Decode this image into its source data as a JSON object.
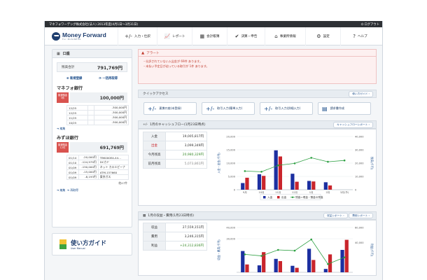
{
  "topbar": {
    "company": "マネフォワーデング株式会社(法人)  2013年度(4月1日〜3月31日)",
    "logout": "ログアウト"
  },
  "brand": {
    "name": "Money Forward",
    "sub": "For BUSINESS"
  },
  "nav": [
    {
      "icon": "plus-minus-icon",
      "glyph": "+/-",
      "label": "入力・仕訳"
    },
    {
      "icon": "chart-icon",
      "glyph": "📈",
      "label": "レポート"
    },
    {
      "icon": "ledger-icon",
      "glyph": "▦",
      "label": "会計帳簿"
    },
    {
      "icon": "check-icon",
      "glyph": "✔",
      "label": "決算・申告"
    },
    {
      "icon": "home-icon",
      "glyph": "⌂",
      "label": "事業所情報"
    },
    {
      "icon": "gear-icon",
      "glyph": "⚙",
      "label": "設定"
    },
    {
      "icon": "help-icon",
      "glyph": "?",
      "label": "ヘルプ"
    }
  ],
  "accounts": {
    "title": "口座",
    "balance_label": "残高合計",
    "balance": "791,769円",
    "new_button": "新規登録",
    "refresh_button": "一括再取得",
    "banks": [
      {
        "name": "マネフォ銀行",
        "tag": "普通預金\n3件",
        "amount": "100,000円",
        "rows": [
          [
            "12/25",
            "",
            "-300,000円"
          ],
          [
            "12/25",
            "",
            "-300,000円"
          ],
          [
            "11/25",
            "",
            "-300,000円"
          ],
          [
            "10/25",
            "",
            "-300,000円"
          ]
        ],
        "link": "編集"
      },
      {
        "name": "みずほ銀行",
        "tag": "普通預金\n12件",
        "amount": "691,769円",
        "rows": [
          [
            "01/14",
            "-20,000円",
            "TBK000EA-44..."
          ],
          [
            "01/10",
            "-124,979円",
            "DCカド"
          ],
          [
            "01/09",
            "-150,000円",
            "ネット カロエピーナ"
          ],
          [
            "01/09",
            "-15,000円",
            "ATM-157660"
          ],
          [
            "01/09",
            "-8,193円",
            "東京ガス"
          ]
        ],
        "more": "他47件",
        "links": [
          "編集",
          "再取得"
        ]
      }
    ]
  },
  "guide": {
    "title": "使い方ガイド",
    "sub": "User Manual"
  },
  "alert": {
    "title": "アラート",
    "lines": [
      "・仕訳されていない入出金が 69件 あります。",
      "・未払い予定日が迫っている取引が 1件 あります。"
    ]
  },
  "quick": {
    "title": "クイックアクセス",
    "guide_button": "使い方ガイド",
    "buttons": [
      "連携口座(未登録)",
      "取引入力(簡単入力)",
      "取引入力(詳細入力)",
      "請求書作成"
    ]
  },
  "cashflow": {
    "title": "1月のキャッシュフロー(1月23日時点)",
    "button": "キャッシュフローレポート",
    "rows": [
      {
        "label": "入金",
        "value": "19,005,817円"
      },
      {
        "label": "出金",
        "value": "3,099,349円"
      },
      {
        "label": "今月残高",
        "value": "20,980,329円"
      },
      {
        "label": "前月残高",
        "value": "5,073,861円"
      }
    ],
    "axis_left_label": "入金・出金(千円)",
    "axis_right_label": "残高(千円)"
  },
  "pnl": {
    "title": "1月の収益・費用(1月23日時点)",
    "buttons": [
      "収益レポート",
      "費用レポート"
    ],
    "rows": [
      {
        "label": "収益",
        "value": "27,559,151円"
      },
      {
        "label": "費用",
        "value": "3,246,315円"
      },
      {
        "label": "利益",
        "value": "+24,312,836円"
      }
    ],
    "axis_left_label": "収益・費用(千円)",
    "axis_right_label": "利益(千円)"
  },
  "colors": {
    "income": "#1c2fa0",
    "expense": "#c9252c",
    "balance": "#2ea043",
    "brand": "#1f3e6f"
  },
  "chart_data": [
    {
      "type": "bar",
      "categories": [
        "9月",
        "10月",
        "11月",
        "12月",
        "1月",
        "2月",
        "3月(予)"
      ],
      "series": [
        {
          "name": "入金",
          "values": [
            2500,
            5800,
            14800,
            6000,
            3300,
            2800,
            0
          ]
        },
        {
          "name": "出金",
          "values": [
            4500,
            5200,
            12500,
            3000,
            3100,
            1600,
            0
          ]
        },
        {
          "name": "残高",
          "type": "line",
          "axis": "right",
          "values": [
            14000,
            13500,
            18300,
            19800,
            24000,
            21000,
            22000
          ]
        }
      ],
      "ylim": [
        0,
        20000
      ],
      "y_ticks": [
        "0",
        "5,000",
        "10,000",
        "15,000",
        "20,000"
      ],
      "y2lim": [
        0,
        40000
      ],
      "y2_ticks": [
        "0",
        "10,000",
        "20,000",
        "30,000",
        "40,000"
      ],
      "legend": "bottom",
      "legend_labels": [
        "入金",
        "出金",
        "残高＝現金・預金の残高"
      ]
    },
    {
      "type": "bar",
      "series": [
        {
          "name": "収益",
          "values": [
            19000,
            6200,
            12000,
            5800,
            21000,
            3000,
            20000
          ]
        },
        {
          "name": "費用",
          "values": [
            7000,
            18000,
            10000,
            4000,
            11000,
            16000,
            29000
          ]
        },
        {
          "name": "利益",
          "type": "line",
          "axis": "right",
          "values": [
            24000,
            22000,
            30000,
            29000,
            44000,
            11000,
            20000
          ]
        }
      ],
      "ylim": [
        0,
        40000
      ],
      "y_ticks": [
        "30,000",
        "40,000"
      ],
      "y2lim": [
        0,
        60000
      ],
      "y2_ticks": [
        "40,000",
        "60,000"
      ]
    }
  ]
}
